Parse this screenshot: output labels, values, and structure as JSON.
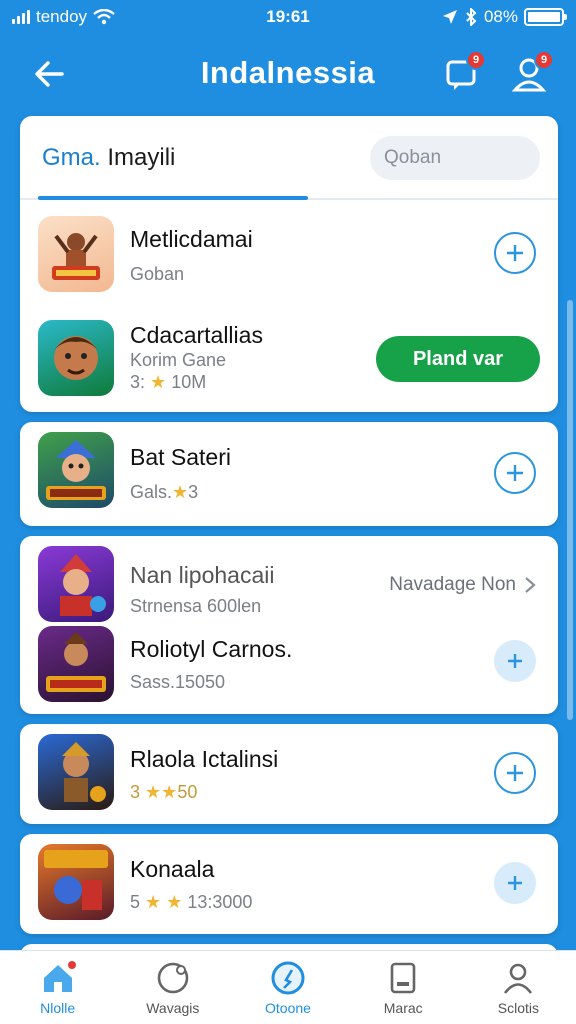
{
  "status": {
    "carrier": "tendoy",
    "time": "19:61",
    "battery": "08%"
  },
  "header": {
    "title": "Indalnessia",
    "notif_badge": "9",
    "profile_badge": "9"
  },
  "tabs": {
    "label_prefix": "Gma.",
    "label_rest": " Imayili",
    "search_placeholder": "Qoban"
  },
  "apps": [
    {
      "name": "Metlicdamai",
      "sub": "Goban",
      "meta": ""
    },
    {
      "name": "Cdacartallias",
      "sub": "Korim Gane",
      "meta_prefix": "3:",
      "meta": "10M",
      "action": "Pland var"
    },
    {
      "name": "Bat Sateri",
      "sub_prefix": "Gals.",
      "meta": "3"
    },
    {
      "name": "Nan lipohacaii",
      "sub": "Strnensa 600len",
      "more": "Navadage Non"
    },
    {
      "name": "Roliotyl Carnos.",
      "sub": "Sass.15050"
    },
    {
      "name": "Rlaola Ictalinsi",
      "meta_prefix": "3",
      "meta": "50"
    },
    {
      "name": "Konaala",
      "meta_prefix": "5",
      "meta": "13:3000"
    }
  ],
  "nav": {
    "items": [
      {
        "label": "Nlolle"
      },
      {
        "label": "Wavagis"
      },
      {
        "label": "Otoone"
      },
      {
        "label": "Marac"
      },
      {
        "label": "Sclotis"
      }
    ]
  },
  "colors": {
    "brand_blue": "#1f8ee0",
    "play_green": "#17a24a",
    "badge_red": "#e53935",
    "star": "#f2b531"
  }
}
